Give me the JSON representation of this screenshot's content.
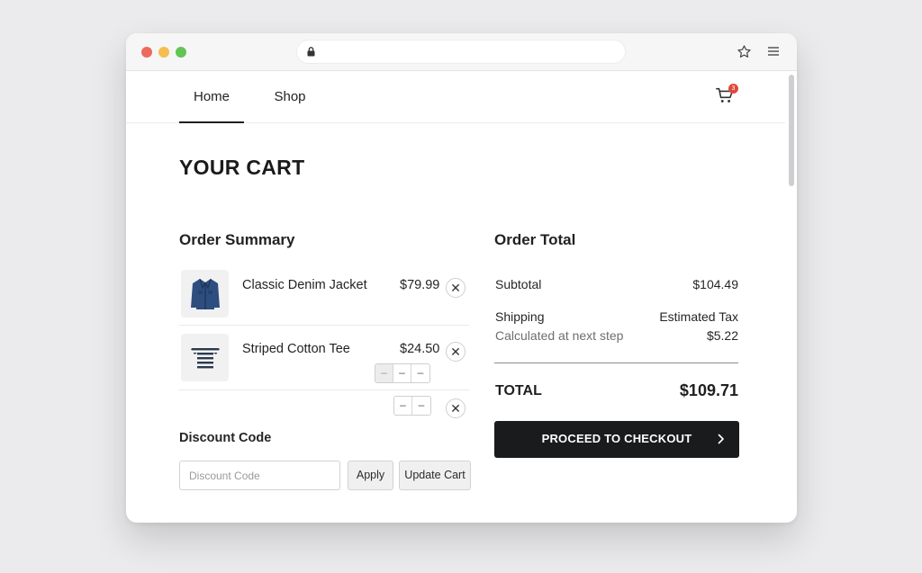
{
  "nav": {
    "tabs": [
      {
        "label": "Home",
        "active": true
      },
      {
        "label": "Shop",
        "active": false
      }
    ],
    "cart_badge": "3"
  },
  "page": {
    "title": "YOUR CART"
  },
  "order_summary": {
    "title": "Order Summary",
    "items": [
      {
        "name": "Classic Denim Jacket",
        "price": "$79.99",
        "icon": "denim-jacket-image"
      },
      {
        "name": "Striped Cotton Tee",
        "price": "$24.50",
        "icon": "striped-tee-image"
      }
    ],
    "stepper_glyph": "–",
    "remove_glyph": "✕"
  },
  "discount": {
    "title": "Discount Code",
    "placeholder": "Discount Code",
    "value": "",
    "apply_label": "Apply",
    "update_label": "Update Cart"
  },
  "order_total": {
    "title": "Order Total",
    "subtotal_label": "Subtotal",
    "subtotal_value": "$104.49",
    "shipping_label": "Shipping",
    "shipping_note": "Calculated at next step",
    "tax_label": "Estimated Tax",
    "tax_value": "$5.22",
    "total_label": "TOTAL",
    "total_value": "$109.71",
    "checkout_label": "PROCEED TO CHECKOUT"
  },
  "colors": {
    "accent_dark": "#1a1b1d",
    "badge": "#e0483c",
    "window_bg": "#ffffff",
    "page_bg": "#ebebed"
  }
}
